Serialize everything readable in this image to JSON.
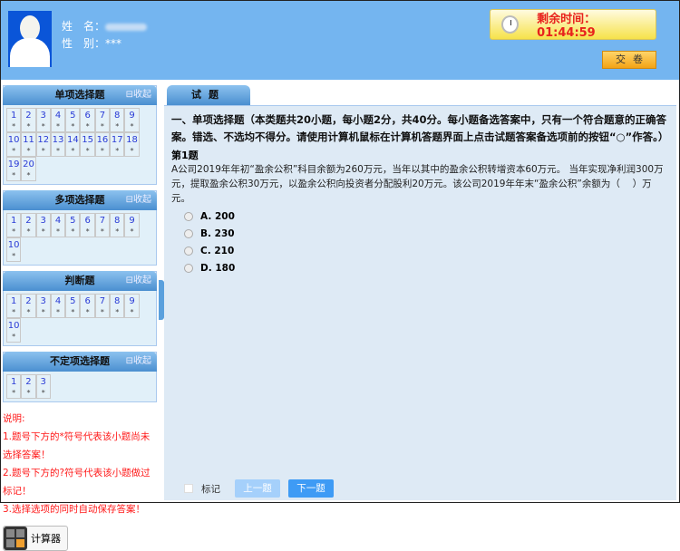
{
  "header": {
    "name_label": "姓　名：",
    "gender_label": "性　别：",
    "gender_value": "***",
    "timer_label": "剩余时间：",
    "timer_value": "01:44:59",
    "submit_label": "交卷"
  },
  "sections": [
    {
      "title": "单项选择题",
      "collapse": "⊟收起",
      "items": [
        "1",
        "2",
        "3",
        "4",
        "5",
        "6",
        "7",
        "8",
        "9",
        "10",
        "11",
        "12",
        "13",
        "14",
        "15",
        "16",
        "17",
        "18",
        "19",
        "20"
      ]
    },
    {
      "title": "多项选择题",
      "collapse": "⊟收起",
      "items": [
        "1",
        "2",
        "3",
        "4",
        "5",
        "6",
        "7",
        "8",
        "9",
        "10"
      ]
    },
    {
      "title": "判断题",
      "collapse": "⊟收起",
      "items": [
        "1",
        "2",
        "3",
        "4",
        "5",
        "6",
        "7",
        "8",
        "9",
        "10"
      ]
    },
    {
      "title": "不定项选择题",
      "collapse": "⊟收起",
      "items": [
        "1",
        "2",
        "3"
      ]
    }
  ],
  "mark_symbol": "*",
  "notes": [
    "说明:",
    "1.题号下方的*符号代表该小题尚未选择答案！",
    "2.题号下方的?符号代表该小题做过标记！",
    "3.选择选项的同时自动保存答案！"
  ],
  "calculator_label": "计算器",
  "main": {
    "tab": "试题",
    "section_title": "一、单项选择题（本类题共20小题，每小题2分，共40分。每小题备选答案中，只有一个符合题意的正确答案。错选、不选均不得分。请使用计算机鼠标在计算机答题界面上点击试题答案备选项前的按钮“○”作答。）",
    "question_no": "第1题",
    "question": "A公司2019年年初“盈余公积”科目余额为260万元，当年以其中的盈余公积转增资本60万元。 当年实现净利润300万元，提取盈余公积30万元，以盈余公积向投资者分配股利20万元。该公司2019年年末“盈余公积”余额为（　 ）万元。",
    "options": [
      "A. 200",
      "B. 230",
      "C. 210",
      "D. 180"
    ],
    "mark_label": "标记",
    "prev_label": "上一题",
    "next_label": "下一题"
  }
}
